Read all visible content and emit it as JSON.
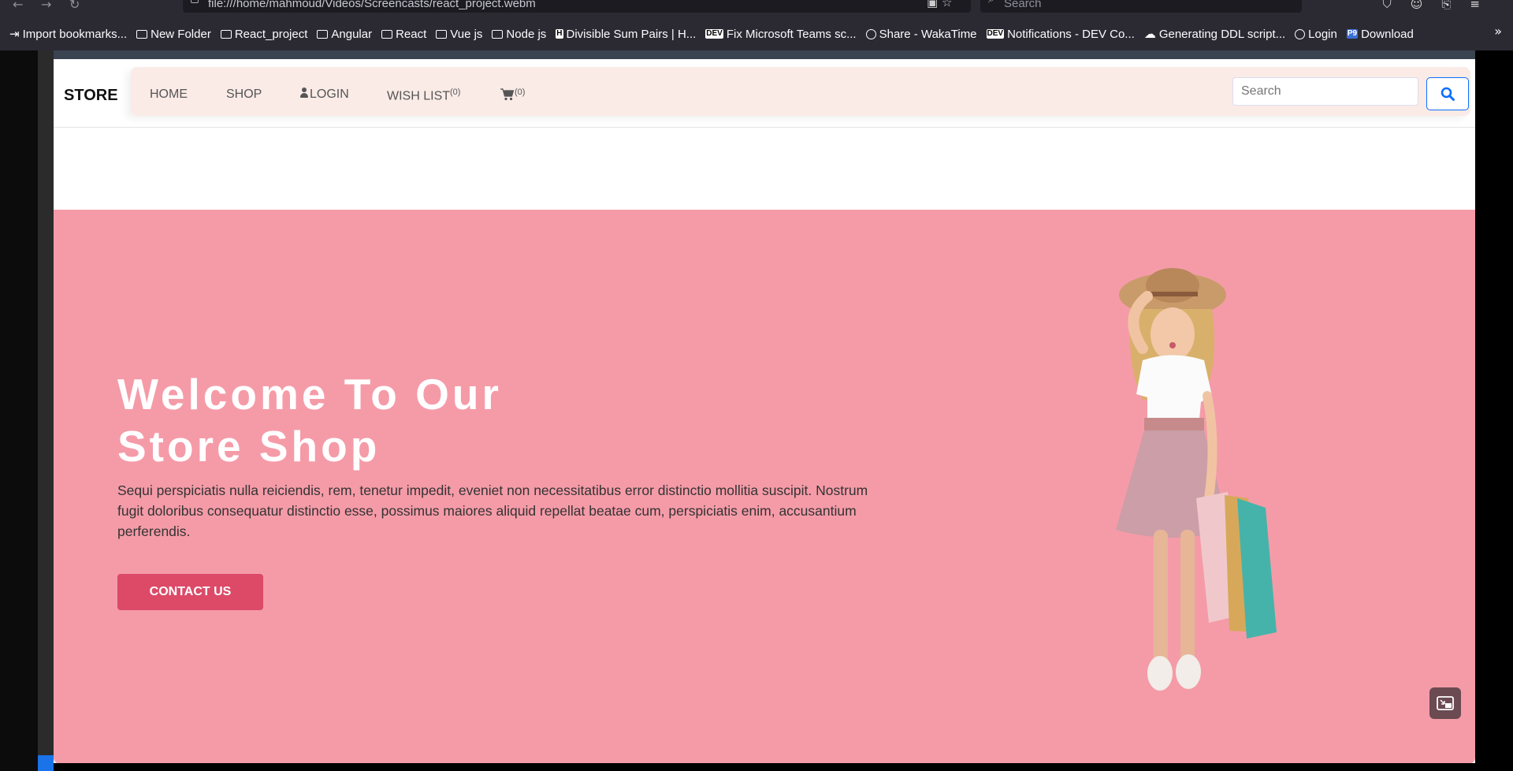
{
  "browser": {
    "url": "file:///home/mahmoud/Videos/Screencasts/react_project.webm",
    "search_placeholder": "Search",
    "bookmarks": [
      {
        "label": "Import bookmarks...",
        "icon": "import-icon"
      },
      {
        "label": "New Folder",
        "icon": "folder-icon"
      },
      {
        "label": "React_project",
        "icon": "folder-icon"
      },
      {
        "label": "Angular",
        "icon": "folder-icon"
      },
      {
        "label": "React",
        "icon": "folder-icon"
      },
      {
        "label": "Vue js",
        "icon": "folder-icon"
      },
      {
        "label": "Node js",
        "icon": "folder-icon"
      },
      {
        "label": "Divisible Sum Pairs | H...",
        "icon": "hackerrank-icon"
      },
      {
        "label": "Fix Microsoft Teams sc...",
        "icon": "dev-icon"
      },
      {
        "label": "Share - WakaTime",
        "icon": "wakatime-icon"
      },
      {
        "label": "Notifications - DEV Co...",
        "icon": "dev-icon"
      },
      {
        "label": "Generating DDL script...",
        "icon": "generic-icon"
      },
      {
        "label": "Login",
        "icon": "globe-icon"
      },
      {
        "label": "Download",
        "icon": "p9-icon"
      }
    ]
  },
  "store": {
    "brand": "STORE",
    "nav": {
      "home": "HOME",
      "shop": "SHOP",
      "login": "LOGIN",
      "wishlist": "WISH LIST",
      "wishlist_count": "(0)",
      "cart_count": "(0)"
    },
    "search_placeholder": "Search",
    "hero": {
      "title_line1": "Welcome To Our",
      "title_line2": "Store Shop",
      "text": "Sequi perspiciatis nulla reiciendis, rem, tenetur impedit, eveniet non necessitatibus error distinctio mollitia suscipit. Nostrum fugit doloribus consequatur distinctio esse, possimus maiores aliquid repellat beatae cum, perspiciatis enim, accusantium perferendis.",
      "button": "CONTACT US"
    }
  },
  "colors": {
    "hero_bg": "#f59ba8",
    "button_bg": "#dc4a68",
    "nav_pill": "#faebe7",
    "search_accent": "#0d6efd"
  }
}
